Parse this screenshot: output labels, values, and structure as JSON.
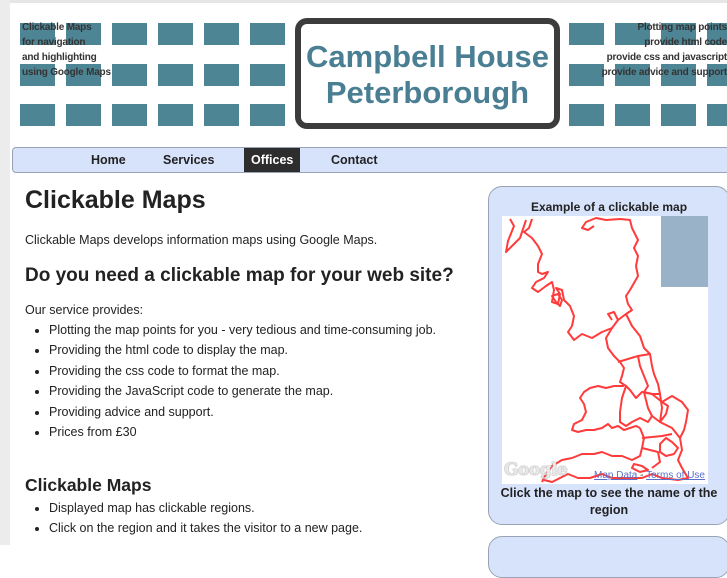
{
  "header": {
    "left_tagline": [
      "Clickable Maps",
      "for navigation",
      "and highlighting",
      "using Google Maps"
    ],
    "logo_line1": "Campbell House",
    "logo_line2": "Peterborough",
    "right_tagline": [
      "Plotting map points",
      "provide html code",
      "provide css and javascript",
      "provide advice and support"
    ],
    "tile_color": "#4e8595",
    "logo_text_color": "#4a7f93"
  },
  "nav": {
    "items": [
      {
        "label": "Home",
        "active": false
      },
      {
        "label": "Services",
        "active": false
      },
      {
        "label": "Offices",
        "active": true
      },
      {
        "label": "Contact",
        "active": false
      }
    ],
    "background": "#d7e2fb",
    "active_background": "#2d2d2d"
  },
  "main": {
    "title": "Clickable Maps",
    "intro": "Clickable Maps develops information maps using Google Maps.",
    "section1": {
      "heading": "Do you need a clickable map for your web site?",
      "lead": "Our service provides:",
      "items": [
        "Plotting the map points for you - very tedious and time-consuming job.",
        "Providing the html code to display the map.",
        "Providing the css code to format the map.",
        "Providing the JavaScript code to generate the map.",
        "Providing advice and support.",
        "Prices from £30"
      ]
    },
    "section2": {
      "heading": "Clickable Maps",
      "items": [
        "Displayed map has clickable regions.",
        "Click on the region and it takes the visitor to a new page."
      ]
    }
  },
  "sidebar": {
    "title": "Example of a clickable map",
    "map_logo": "Google",
    "map_data_link": "Map Data",
    "separator": " - ",
    "terms_link": "Terms of Use",
    "caption": "Click the map to see the name of the region",
    "region_outline_color": "#ff3b3b"
  }
}
